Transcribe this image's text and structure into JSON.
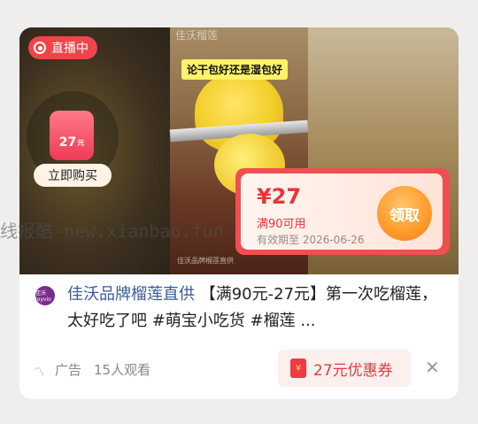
{
  "live": {
    "label": "直播中"
  },
  "buy_widget": {
    "price": "27",
    "unit": "元",
    "button": "立即购买"
  },
  "video": {
    "caption": "论干包好还是湿包好",
    "mark": "佳沃榴莲",
    "small_watermark": "佳沃品牌榴莲直供"
  },
  "coupon": {
    "amount": "¥27",
    "condition": "满90可用",
    "expiry": "有效期至 2026-06-26",
    "claim": "领取"
  },
  "site_watermark": "线报酷-new.xianbao.fun",
  "post": {
    "logo_text": "佳沃 joyvio",
    "brand": "佳沃品牌榴莲直供",
    "text": " 【满90元-27元】第一次吃榴莲，太好吃了吧 #萌宝小吃货 #榴莲 ..."
  },
  "footer": {
    "ad_label": "广告",
    "viewers": "15人观看",
    "coupon_button": "27元优惠券",
    "close": "✕"
  },
  "colors": {
    "accent": "#f04f52",
    "live": "#f0444a",
    "brand_link": "#3a5a9a",
    "claim": "#ff9a2a"
  }
}
